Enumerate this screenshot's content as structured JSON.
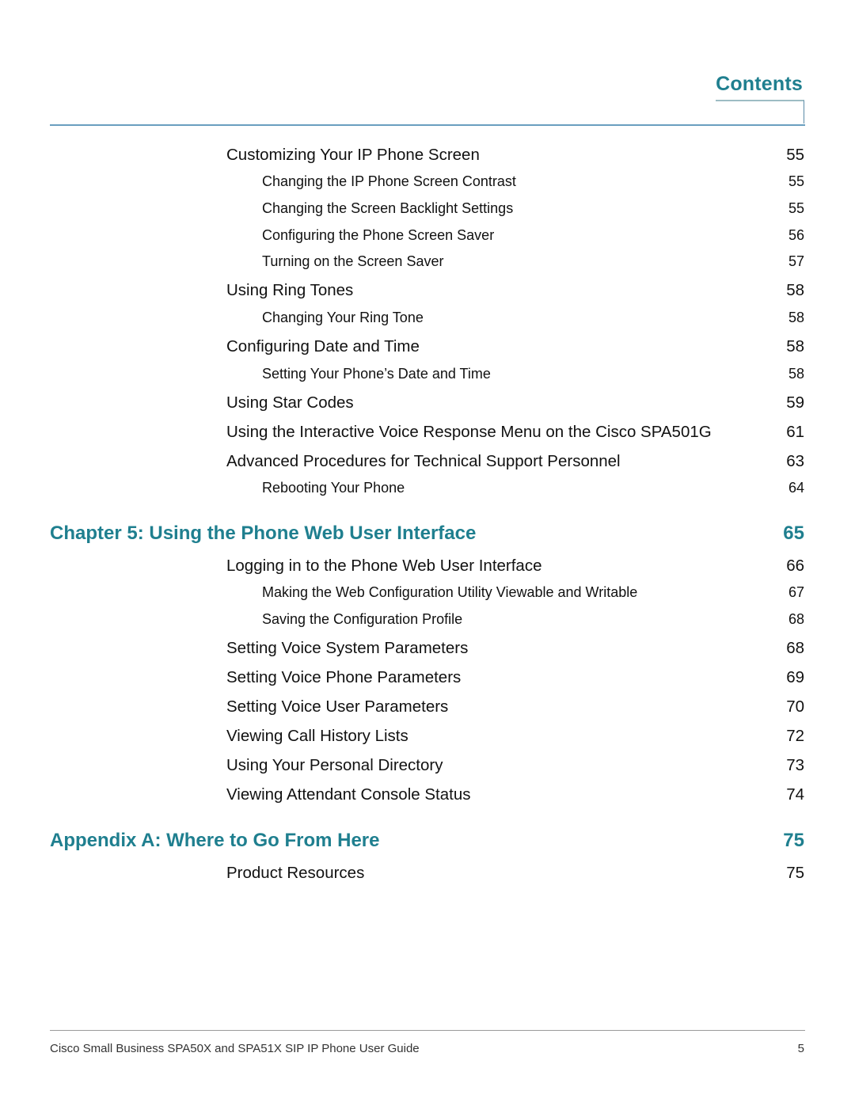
{
  "header": {
    "title": "Contents"
  },
  "toc": [
    {
      "level": 2,
      "text": "Customizing Your IP Phone Screen",
      "page": "55"
    },
    {
      "level": 3,
      "text": "Changing the IP Phone Screen Contrast",
      "page": "55"
    },
    {
      "level": 3,
      "text": "Changing the Screen Backlight Settings",
      "page": "55"
    },
    {
      "level": 3,
      "text": "Configuring the Phone Screen Saver",
      "page": "56"
    },
    {
      "level": 3,
      "text": "Turning on the Screen Saver",
      "page": "57"
    },
    {
      "level": 2,
      "text": "Using Ring Tones",
      "page": "58"
    },
    {
      "level": 3,
      "text": "Changing Your Ring Tone",
      "page": "58"
    },
    {
      "level": 2,
      "text": "Configuring Date and Time",
      "page": "58"
    },
    {
      "level": 3,
      "text": "Setting Your Phone’s Date and Time",
      "page": "58"
    },
    {
      "level": 2,
      "text": "Using Star Codes",
      "page": "59"
    },
    {
      "level": 2,
      "text": "Using the Interactive Voice Response Menu on the Cisco SPA501G",
      "page": "61"
    },
    {
      "level": 2,
      "text": "Advanced Procedures for Technical Support Personnel",
      "page": "63"
    },
    {
      "level": 3,
      "text": "Rebooting Your Phone",
      "page": "64"
    },
    {
      "level": 1,
      "text": "Chapter 5: Using the Phone Web User Interface",
      "page": "65"
    },
    {
      "level": 2,
      "text": "Logging in to the Phone Web User Interface",
      "page": "66"
    },
    {
      "level": 3,
      "text": "Making the Web Configuration Utility Viewable and Writable",
      "page": "67"
    },
    {
      "level": 3,
      "text": "Saving the Configuration Profile",
      "page": "68"
    },
    {
      "level": 2,
      "text": "Setting Voice System Parameters",
      "page": "68"
    },
    {
      "level": 2,
      "text": "Setting Voice Phone Parameters",
      "page": "69"
    },
    {
      "level": 2,
      "text": "Setting Voice User Parameters",
      "page": "70"
    },
    {
      "level": 2,
      "text": "Viewing Call History Lists",
      "page": "72"
    },
    {
      "level": 2,
      "text": "Using Your Personal Directory",
      "page": "73"
    },
    {
      "level": 2,
      "text": "Viewing Attendant Console Status",
      "page": "74"
    },
    {
      "level": 1,
      "text": "Appendix A: Where to Go From Here",
      "page": "75"
    },
    {
      "level": 2,
      "text": "Product Resources",
      "page": "75"
    }
  ],
  "footer": {
    "text": "Cisco Small Business SPA50X and SPA51X SIP IP Phone User Guide",
    "page": "5"
  },
  "colors": {
    "accent": "#1f7f8f",
    "rule": "#6a9fbf"
  }
}
